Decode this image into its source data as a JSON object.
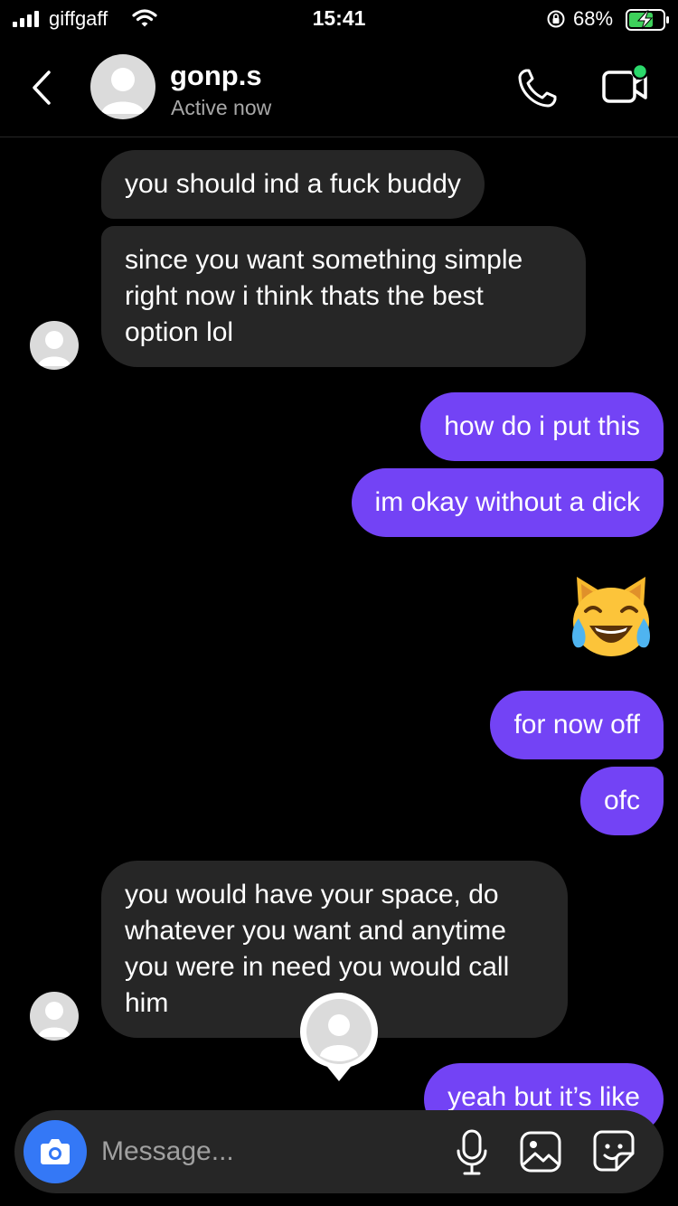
{
  "status_bar": {
    "carrier": "giffgaff",
    "time": "15:41",
    "battery_percent": "68%"
  },
  "header": {
    "contact_name": "gonp.s",
    "contact_status": "Active now"
  },
  "messages": [
    {
      "direction": "incoming",
      "text": "you should ind a fuck buddy"
    },
    {
      "direction": "incoming",
      "text": "since you want something simple right now i think thats the best option lol"
    },
    {
      "direction": "outgoing",
      "text": "how do i put this"
    },
    {
      "direction": "outgoing",
      "text": "im okay without a dick"
    },
    {
      "direction": "outgoing",
      "text": "😹",
      "icon": "cat-tears-of-joy-emoji"
    },
    {
      "direction": "outgoing",
      "text": "for now off"
    },
    {
      "direction": "outgoing",
      "text": "ofc"
    },
    {
      "direction": "incoming",
      "text": "you would have your space, do whatever you want and anytime you were in need you would call him"
    },
    {
      "direction": "outgoing",
      "text": "yeah but it’s like"
    }
  ],
  "composer": {
    "placeholder": "Message..."
  },
  "colors": {
    "background": "#000000",
    "incoming_bubble": "#262626",
    "outgoing_bubble": "#7343f5",
    "camera_button": "#3478f6",
    "online_dot": "#2bd96b"
  }
}
